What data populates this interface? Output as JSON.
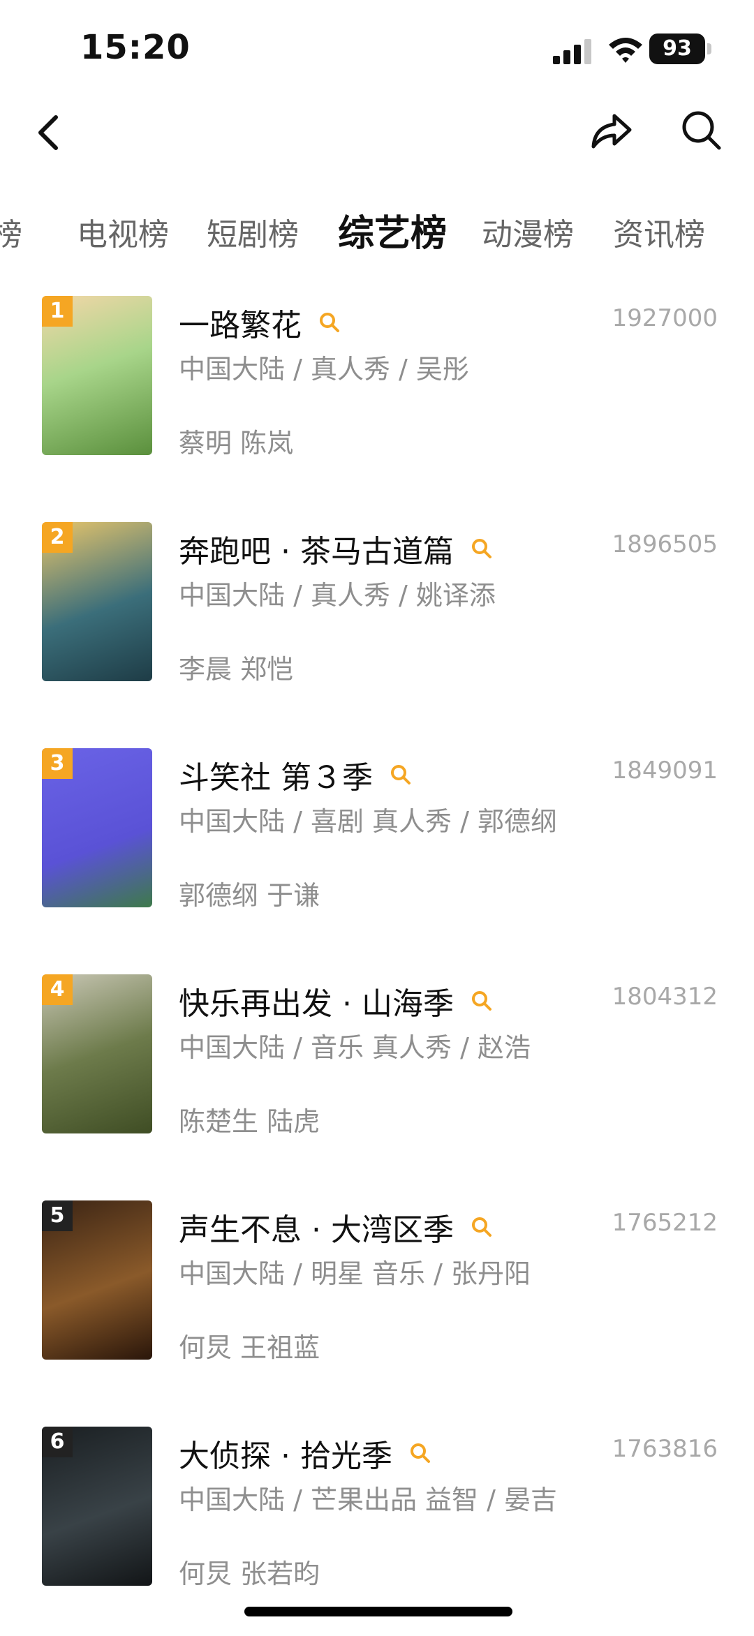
{
  "status_bar": {
    "time": "15:20",
    "battery": "93"
  },
  "tabs": [
    "榜",
    "电视榜",
    "短剧榜",
    "综艺榜",
    "动漫榜",
    "资讯榜"
  ],
  "active_tab": "综艺榜",
  "items": [
    {
      "rank": "1",
      "title": "一路繁花",
      "count": "1927000",
      "meta": "中国大陆 / 真人秀 / 吴彤",
      "cast": "蔡明 陈岚",
      "rank_color": "#f5a623"
    },
    {
      "rank": "2",
      "title": "奔跑吧 · 茶马古道篇",
      "count": "1896505",
      "meta": "中国大陆 / 真人秀 / 姚译添",
      "cast": "李晨 郑恺",
      "rank_color": "#f5a623"
    },
    {
      "rank": "3",
      "title": "斗笑社 第３季",
      "count": "1849091",
      "meta": "中国大陆 / 喜剧 真人秀 / 郭德纲",
      "cast": "郭德纲 于谦",
      "rank_color": "#f5a623"
    },
    {
      "rank": "4",
      "title": "快乐再出发 · 山海季",
      "count": "1804312",
      "meta": "中国大陆 / 音乐 真人秀 / 赵浩",
      "cast": "陈楚生 陆虎",
      "rank_color": "#f5a623"
    },
    {
      "rank": "5",
      "title": "声生不息 · 大湾区季",
      "count": "1765212",
      "meta": "中国大陆 / 明星 音乐 / 张丹阳",
      "cast": "何炅 王祖蓝",
      "rank_color": "#222222"
    },
    {
      "rank": "6",
      "title": "大侦探 · 拾光季",
      "count": "1763816",
      "meta": "中国大陆 / 芒果出品 益智 / 晏吉",
      "cast": "何炅 张若昀",
      "rank_color": "#222222"
    }
  ],
  "icons": {
    "back": "chevron-left-icon",
    "share": "share-icon",
    "search": "search-icon",
    "item_search": "search-icon"
  },
  "colors": {
    "accent": "#f5a623",
    "muted": "#8e8e8e",
    "count": "#a8a8a8"
  }
}
